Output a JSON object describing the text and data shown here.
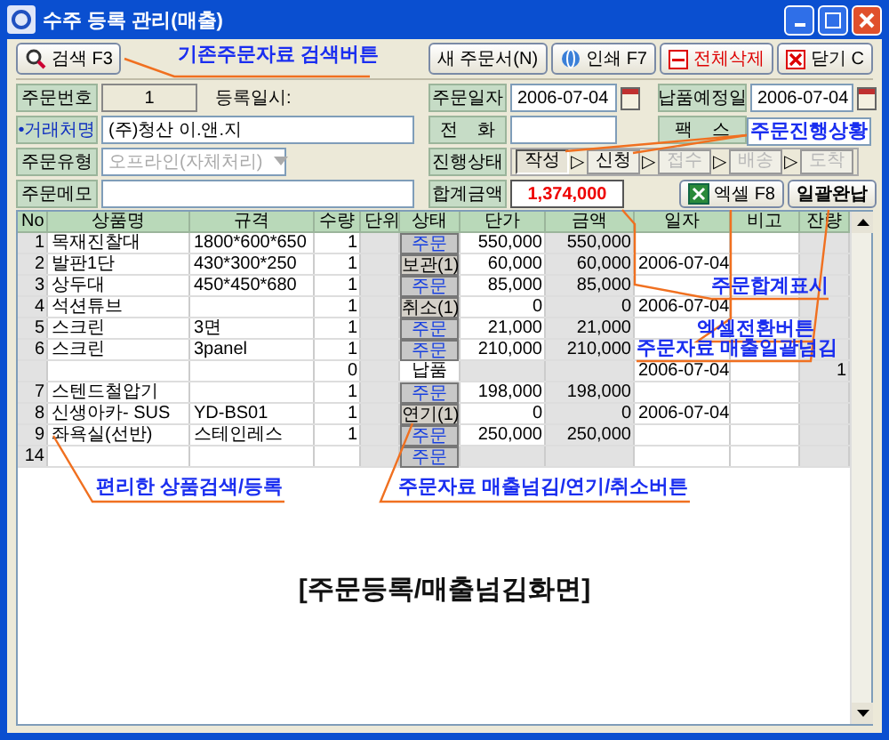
{
  "window": {
    "title": "수주 등록 관리(매출)"
  },
  "toolbar": {
    "search_button": "검색 F3",
    "buttons": [
      {
        "kind": "new",
        "label": "새 주문서(N)"
      },
      {
        "kind": "print",
        "label": "인쇄 F7"
      },
      {
        "kind": "delete",
        "label": "전체삭제"
      },
      {
        "kind": "close",
        "label": "닫기 C"
      }
    ]
  },
  "form": {
    "order_number": {
      "label": "주문번호",
      "value": "1"
    },
    "registered_label": "등록일시:",
    "customer": {
      "label": "•거래처명",
      "required": true,
      "value": "(주)청산 이.앤.지"
    },
    "order_type": {
      "label": "주문유형",
      "value": "오프라인(자체처리)",
      "disabled": true
    },
    "memo": {
      "label": "주문메모"
    },
    "order_date": {
      "label": "주문일자",
      "value": "2006-07-04"
    },
    "delivery_date": {
      "label": "납품예정일",
      "value": "2006-07-04"
    },
    "phone": {
      "label": "전    화"
    },
    "fax": {
      "label": "팩    스"
    },
    "status": {
      "label": "진행상태",
      "arrow": "▷",
      "steps": [
        {
          "label": "작성",
          "selected": true,
          "disabled": false
        },
        {
          "label": "신청",
          "selected": false,
          "disabled": false
        },
        {
          "label": "접수",
          "selected": false,
          "disabled": true
        },
        {
          "label": "배송",
          "selected": false,
          "disabled": true
        },
        {
          "label": "도착",
          "selected": false,
          "disabled": true
        }
      ]
    },
    "total": {
      "label": "합계금액",
      "value": "1,374,000"
    },
    "excel_button": "엑셀 F8",
    "settle_button": "일괄완납"
  },
  "table": {
    "columns": [
      "No",
      "상품명",
      "규격",
      "수량",
      "단위",
      "상태",
      "단가",
      "금액",
      "일자",
      "비고",
      "잔량"
    ],
    "rows": [
      {
        "no": "1",
        "name": "목재진찰대",
        "spec": "1800*600*650",
        "qty": "1",
        "status": {
          "kind": "button",
          "label": "주문",
          "order": true
        },
        "price": "550,000",
        "amount": "550,000",
        "date": "",
        "remain": ""
      },
      {
        "no": "2",
        "name": "발판1단",
        "spec": "430*300*250",
        "qty": "1",
        "status": {
          "kind": "button",
          "label": "보관(1)",
          "order": false
        },
        "price": "60,000",
        "amount": "60,000",
        "date": "2006-07-04",
        "remain": ""
      },
      {
        "no": "3",
        "name": "상두대",
        "spec": "450*450*680",
        "qty": "1",
        "status": {
          "kind": "button",
          "label": "주문",
          "order": true
        },
        "price": "85,000",
        "amount": "85,000",
        "date": "",
        "remain": ""
      },
      {
        "no": "4",
        "name": "석션튜브",
        "spec": "",
        "qty": "1",
        "status": {
          "kind": "button",
          "label": "취소(1)",
          "order": false
        },
        "price": "0",
        "amount": "0",
        "date": "2006-07-04",
        "remain": ""
      },
      {
        "no": "5",
        "name": "스크린",
        "spec": "3면",
        "qty": "1",
        "status": {
          "kind": "button",
          "label": "주문",
          "order": true
        },
        "price": "21,000",
        "amount": "21,000",
        "date": "",
        "remain": ""
      },
      {
        "no": "6",
        "name": "스크린",
        "spec": "3panel",
        "qty": "1",
        "status": {
          "kind": "button",
          "label": "주문",
          "order": true
        },
        "price": "210,000",
        "amount": "210,000",
        "date": "",
        "remain": ""
      },
      {
        "no": "",
        "name": "",
        "spec": "",
        "qty": "0",
        "status": {
          "kind": "text",
          "label": "납품"
        },
        "price": "",
        "amount": "",
        "date": "2006-07-04",
        "remain": "1"
      },
      {
        "no": "7",
        "name": "스텐드철압기",
        "spec": "",
        "qty": "1",
        "status": {
          "kind": "button",
          "label": "주문",
          "order": true
        },
        "price": "198,000",
        "amount": "198,000",
        "date": "",
        "remain": ""
      },
      {
        "no": "8",
        "name": "신생아카- SUS",
        "spec": "YD-BS01",
        "qty": "1",
        "status": {
          "kind": "button",
          "label": "연기(1)",
          "order": false
        },
        "price": "0",
        "amount": "0",
        "date": "2006-07-04",
        "remain": ""
      },
      {
        "no": "9",
        "name": "좌욕실(선반)",
        "spec": "스테인레스",
        "qty": "1",
        "status": {
          "kind": "button",
          "label": "주문",
          "order": true
        },
        "price": "250,000",
        "amount": "250,000",
        "date": "",
        "remain": ""
      },
      {
        "no": "14",
        "name": "",
        "spec": "",
        "qty": "",
        "status": {
          "kind": "button",
          "label": "주문",
          "order": true
        },
        "price": "",
        "amount": "",
        "date": "",
        "remain": ""
      }
    ]
  },
  "annotations": [
    {
      "kind": "search",
      "text": "기존주문자료 검색버튼"
    },
    {
      "kind": "progress",
      "text": "주문진행상황"
    },
    {
      "kind": "total",
      "text": "주문합계표시"
    },
    {
      "kind": "excel",
      "text": "엑셀전환버튼"
    },
    {
      "kind": "settle",
      "text": "주문자료 매출일괄넘김"
    },
    {
      "kind": "product",
      "text": "편리한 상품검색/등록"
    },
    {
      "kind": "status",
      "text": "주문자료 매출넘김/연기/취소버튼"
    }
  ],
  "caption": "[주문등록/매출넘김화면]"
}
